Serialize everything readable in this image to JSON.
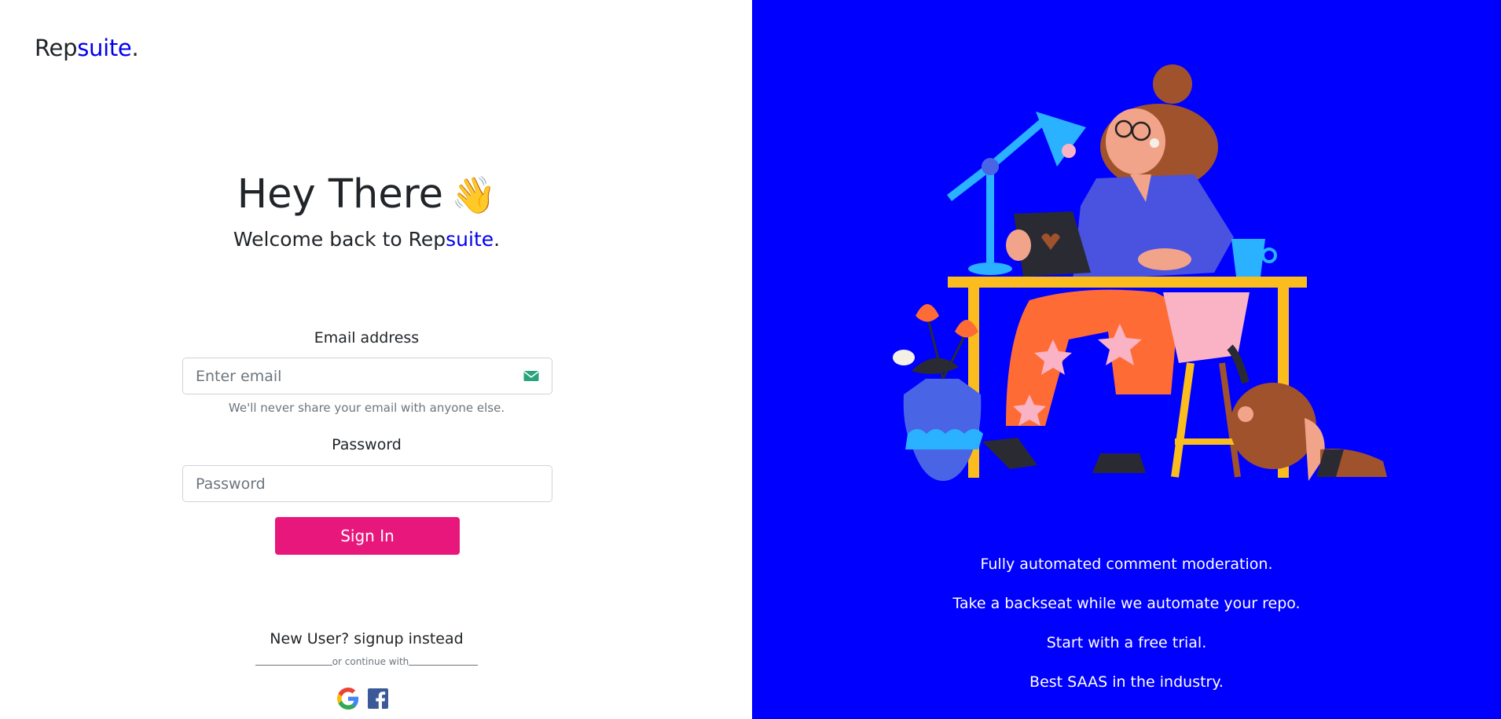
{
  "brand": {
    "prefix": "Rep",
    "suffix": "suite",
    "dot": "."
  },
  "hero": {
    "title": "Hey There",
    "wave_emoji": "👋",
    "welcome_prefix": "Welcome back to ",
    "welcome_brand_prefix": "Rep",
    "welcome_brand_suffix": "suite",
    "welcome_dot": "."
  },
  "form": {
    "email_label": "Email address",
    "email_placeholder": "Enter email",
    "email_value": "",
    "email_hint": "We'll never share your email with anyone else.",
    "password_label": "Password",
    "password_placeholder": "Password",
    "password_value": "",
    "signin_label": "Sign In",
    "signup_text": "New User? signup instead",
    "continue_text": "or continue with"
  },
  "social": [
    {
      "name": "google",
      "icon": "google-icon"
    },
    {
      "name": "facebook",
      "icon": "facebook-icon"
    }
  ],
  "taglines": [
    "Fully automated comment moderation.",
    "Take a backseat while we automate your repo.",
    "Start with a free trial.",
    "Best SAAS in the industry."
  ],
  "colors": {
    "brand_blue": "#0000ee",
    "panel_blue": "#0000ff",
    "signin_pink": "#e8177c",
    "desk_yellow": "#fbbd1d",
    "pants_orange": "#ff6b35"
  }
}
